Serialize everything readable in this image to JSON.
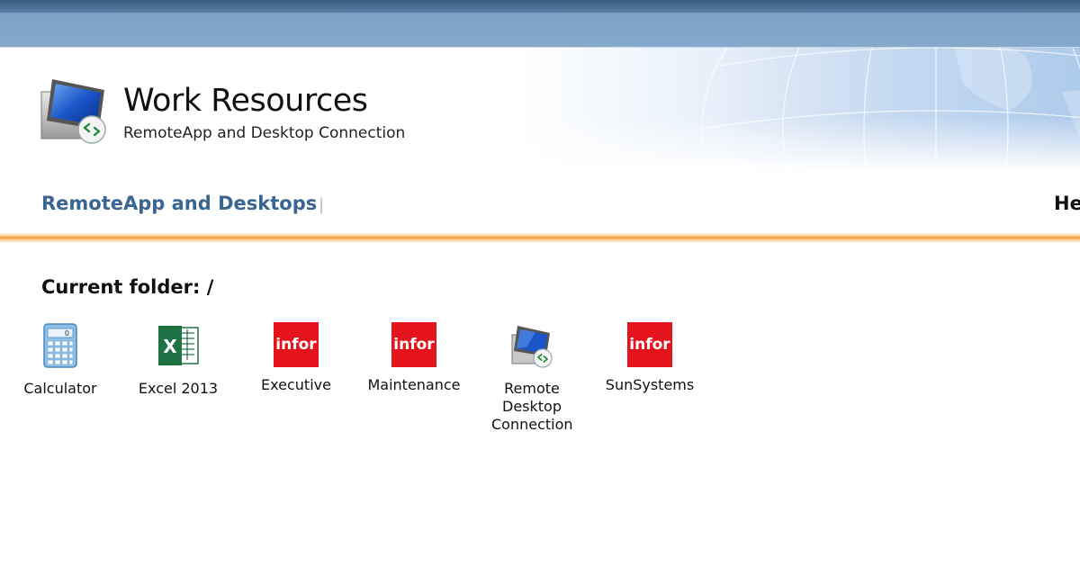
{
  "header": {
    "title": "Work Resources",
    "subtitle": "RemoteApp and Desktop Connection",
    "logo_icon": "remote-desktop-monitor-icon"
  },
  "nav": {
    "primary_link": "RemoteApp and Desktops",
    "separator": "|",
    "help_link": "He"
  },
  "folder": {
    "label": "Current folder: /"
  },
  "apps": [
    {
      "label": "Calculator",
      "icon": "calculator-icon"
    },
    {
      "label": "Excel 2013",
      "icon": "excel-icon",
      "icon_text": "X"
    },
    {
      "label": "Executive",
      "icon": "infor-icon",
      "icon_text": "infor"
    },
    {
      "label": "Maintenance",
      "icon": "infor-icon",
      "icon_text": "infor"
    },
    {
      "label": "Remote Desktop Connection",
      "icon": "remote-desktop-icon"
    },
    {
      "label": "SunSystems",
      "icon": "infor-icon",
      "icon_text": "infor"
    }
  ],
  "colors": {
    "nav_link": "#3a6591",
    "accent_line": "#f39c3a",
    "infor_red": "#e4131c",
    "excel_green": "#1f7244"
  }
}
